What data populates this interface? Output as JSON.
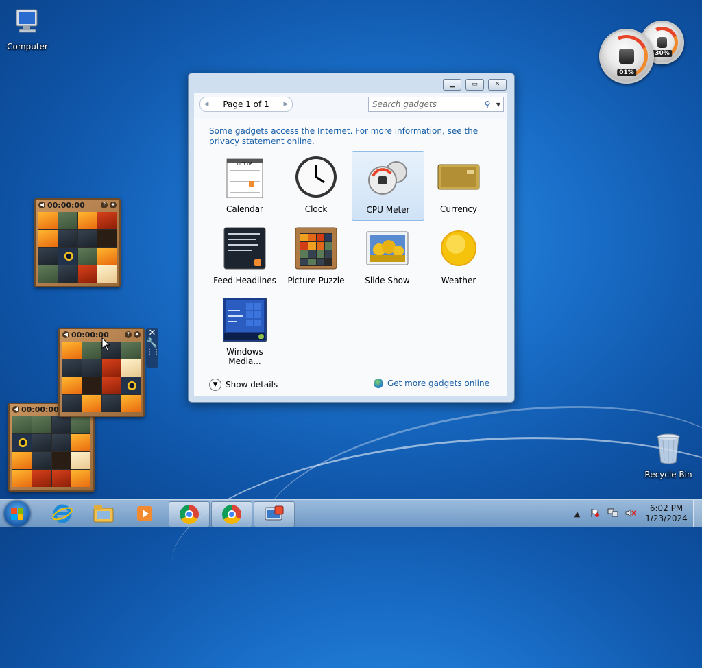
{
  "desktop": {
    "computer_label": "Computer",
    "recycle_label": "Recycle Bin"
  },
  "cpu_meter": {
    "cpu_value": "01%",
    "memory_value": "30%"
  },
  "puzzles": [
    {
      "timer": "00:00:00"
    },
    {
      "timer": "00:00:00"
    },
    {
      "timer": "00:00:00"
    }
  ],
  "window": {
    "pager": {
      "text": "Page 1 of 1"
    },
    "search": {
      "placeholder": "Search gadgets"
    },
    "notice": "Some gadgets access the Internet.  For more information, see the privacy statement online.",
    "gadgets": [
      {
        "label": "Calendar"
      },
      {
        "label": "Clock"
      },
      {
        "label": "CPU Meter"
      },
      {
        "label": "Currency"
      },
      {
        "label": "Feed Headlines"
      },
      {
        "label": "Picture Puzzle"
      },
      {
        "label": "Slide Show"
      },
      {
        "label": "Weather"
      },
      {
        "label": "Windows Media..."
      }
    ],
    "calendar_month": "OCT 06",
    "show_details": "Show details",
    "get_more": "Get more gadgets online"
  },
  "taskbar": {
    "time": "6:02 PM",
    "date": "1/23/2024"
  },
  "icons": [
    "computer-icon",
    "recycle-bin-icon",
    "start-icon",
    "ie-icon",
    "explorer-icon",
    "media-player-icon",
    "chrome-icon",
    "gadgets-icon",
    "flag-icon",
    "network-icon",
    "volume-muted-icon"
  ]
}
